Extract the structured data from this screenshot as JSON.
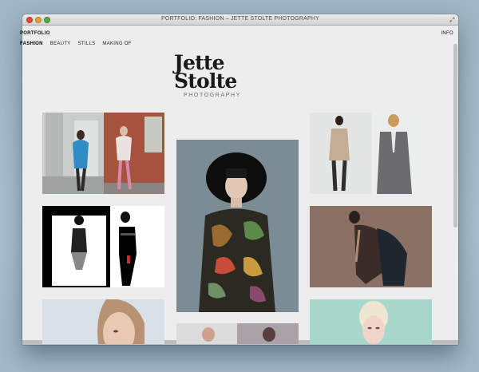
{
  "window": {
    "title": "PORTFOLIO: FASHION – JETTE STOLTE PHOTOGRAPHY"
  },
  "nav": {
    "section": "PORTFOLIO",
    "items": [
      {
        "label": "FASHION",
        "active": true
      },
      {
        "label": "BEAUTY",
        "active": false
      },
      {
        "label": "STILLS",
        "active": false
      },
      {
        "label": "MAKING OF",
        "active": false
      }
    ],
    "info": "INFO"
  },
  "logo": {
    "line1": "Jette",
    "line2": "Stolte",
    "subtitle": "PHOTOGRAPHY"
  },
  "gallery": [
    {
      "name": "photo-street-models"
    },
    {
      "name": "photo-bw-frame"
    },
    {
      "name": "photo-beauty-blonde"
    },
    {
      "name": "photo-hat-floral-shirt"
    },
    {
      "name": "photo-bottom-strip"
    },
    {
      "name": "photo-men-coats"
    },
    {
      "name": "photo-jacket-brown"
    },
    {
      "name": "photo-platinum-portrait"
    }
  ],
  "colors": {
    "background": "#ededed",
    "text": "#1a1a1a",
    "muted": "#6e6e6e"
  }
}
